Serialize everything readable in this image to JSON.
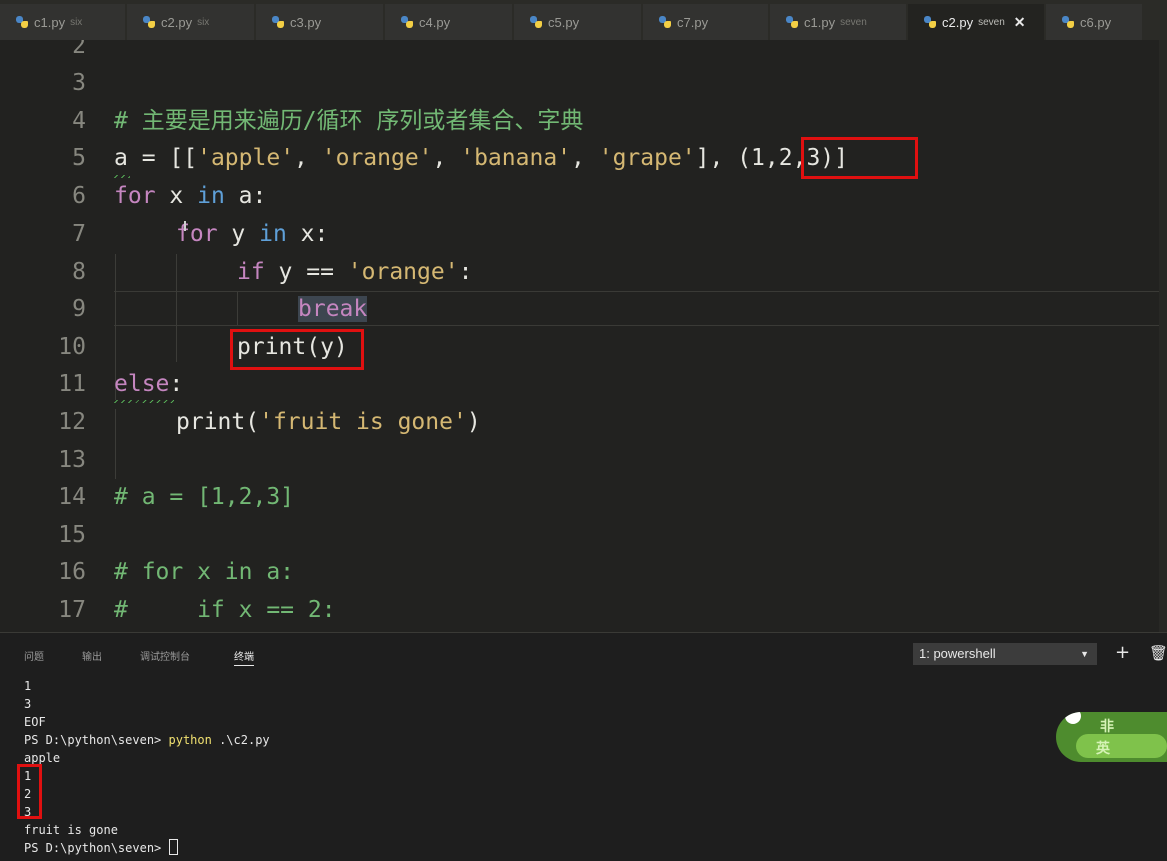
{
  "tabs": [
    {
      "name": "c1.py",
      "sub": "six",
      "active": false
    },
    {
      "name": "c2.py",
      "sub": "six",
      "active": false
    },
    {
      "name": "c3.py",
      "sub": "",
      "active": false
    },
    {
      "name": "c4.py",
      "sub": "",
      "active": false
    },
    {
      "name": "c5.py",
      "sub": "",
      "active": false
    },
    {
      "name": "c7.py",
      "sub": "",
      "active": false
    },
    {
      "name": "c1.py",
      "sub": "seven",
      "active": false
    },
    {
      "name": "c2.py",
      "sub": "seven",
      "active": true
    },
    {
      "name": "c6.py",
      "sub": "",
      "active": false
    }
  ],
  "active_tab_close": "✕",
  "editor": {
    "line_numbers": [
      "2",
      "3",
      "4",
      "5",
      "6",
      "7",
      "8",
      "9",
      "10",
      "11",
      "12",
      "13",
      "14",
      "15",
      "16",
      "17"
    ],
    "lines": {
      "l4": "# 主要是用来遍历/循环 序列或者集合、字典",
      "l5_a": "a",
      "l5_eq": " = [[",
      "l5_s1": "'apple'",
      "l5_c1": ", ",
      "l5_s2": "'orange'",
      "l5_c2": ", ",
      "l5_s3": "'banana'",
      "l5_c3": ", ",
      "l5_s4": "'grape'",
      "l5_c4": "], ",
      "l5_tuple": "(1,2,3)",
      "l5_end": "]",
      "l6_for": "for",
      "l6_x": " x ",
      "l6_in": "in",
      "l6_a": " a:",
      "l7_for": "for",
      "l7_y": " y ",
      "l7_in": "in",
      "l7_x": " x:",
      "l8_if": "if",
      "l8_cond": " y == ",
      "l8_str": "'orange'",
      "l8_colon": ":",
      "l9_break": "break",
      "l10_print": "print(y)",
      "l11_else": "else",
      "l11_colon": ":",
      "l12_print": "print(",
      "l12_str": "'fruit is gone'",
      "l12_close": ")",
      "l14": "# a = [1,2,3]",
      "l16": "# for x in a:",
      "l17": "#     if x == 2:"
    }
  },
  "panel": {
    "tabs": [
      "问题",
      "输出",
      "调试控制台",
      "终端"
    ],
    "active_tab": "终端",
    "terminal_select": "1: powershell",
    "add_terminal": "+",
    "kill_terminal": "🗑",
    "terminal": {
      "lines_before": [
        "1",
        "3",
        "EOF"
      ],
      "prompt": "PS D:\\python\\seven> ",
      "cmd": "python",
      "args": " .\\c2.py",
      "output": [
        "apple",
        "1",
        "2",
        "3",
        "fruit is gone"
      ],
      "final_prompt": "PS D:\\python\\seven> "
    }
  },
  "badge": {
    "text1": "非",
    "text2": "英"
  },
  "colors": {
    "red_highlight": "#e01010",
    "keyword": "#5fa0d8",
    "string": "#d5b873",
    "comment": "#72b874",
    "purple_keyword": "#c586c0"
  }
}
